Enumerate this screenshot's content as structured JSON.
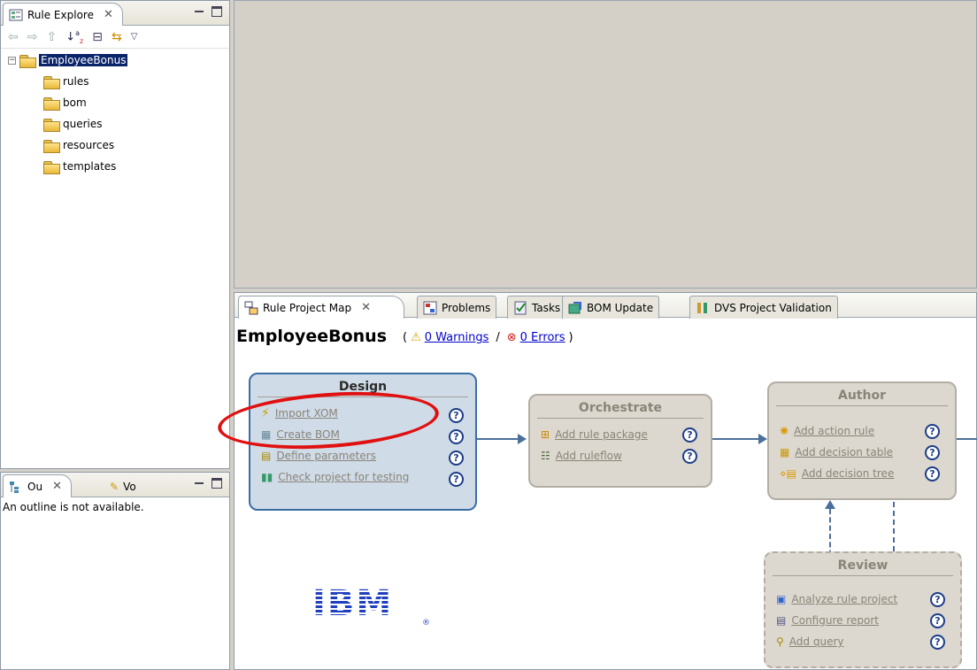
{
  "explorer": {
    "tab_label": "Rule Explore",
    "tree": [
      {
        "label": "EmployeeBonus",
        "selected": true
      },
      {
        "label": "rules"
      },
      {
        "label": "bom"
      },
      {
        "label": "queries"
      },
      {
        "label": "resources"
      },
      {
        "label": "templates"
      }
    ]
  },
  "outline": {
    "tab1": "Ou",
    "tab2": "Vo",
    "message": "An outline is not available."
  },
  "map_tabs": [
    {
      "label": "Rule Project Map",
      "active": true
    },
    {
      "label": "Problems"
    },
    {
      "label": "Tasks"
    },
    {
      "label": "BOM Update"
    },
    {
      "label": "DVS Project Validation"
    }
  ],
  "map": {
    "project": "EmployeeBonus",
    "open_paren": "(",
    "warnings": "0 Warnings",
    "separator": "/",
    "errors": "0 Errors",
    "close_paren": ")",
    "help_glyph": "?",
    "design": {
      "title": "Design",
      "actions": [
        "Import XOM",
        "Create BOM",
        "Define parameters",
        "Check project for testing"
      ]
    },
    "orchestrate": {
      "title": "Orchestrate",
      "actions": [
        "Add rule package",
        "Add ruleflow"
      ]
    },
    "author": {
      "title": "Author",
      "actions": [
        "Add action rule",
        "Add decision table",
        "Add decision tree"
      ]
    },
    "review": {
      "title": "Review",
      "actions": [
        "Analyze rule project",
        "Configure report",
        "Add query"
      ]
    },
    "logo": "IBM",
    "logo_reg": "®"
  },
  "colors": {
    "highlight": "#e01010",
    "link": "#0000cc",
    "active_box_border": "#3b6da5"
  }
}
